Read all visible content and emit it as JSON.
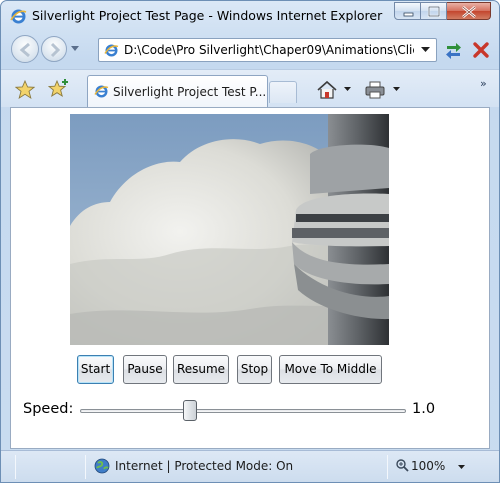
{
  "window": {
    "title": "Silverlight Project Test Page - Windows Internet Explorer"
  },
  "address": {
    "url": "D:\\Code\\Pro Silverlight\\Chaper09\\Animations\\Clie"
  },
  "tabs": [
    {
      "label": "Silverlight Project Test P..."
    }
  ],
  "content": {
    "image_alt": "clouds-and-tower-photo",
    "buttons": {
      "start": "Start",
      "pause": "Pause",
      "resume": "Resume",
      "stop": "Stop",
      "move_to_middle": "Move To Middle"
    },
    "speed": {
      "label": "Speed:",
      "value": "1.0",
      "fraction": 0.33
    }
  },
  "status": {
    "zone": "Internet | Protected Mode: On",
    "zoom": "100%"
  },
  "colors": {
    "sky": "#8aa9c8",
    "frame_accent": "#6d8fb5"
  }
}
